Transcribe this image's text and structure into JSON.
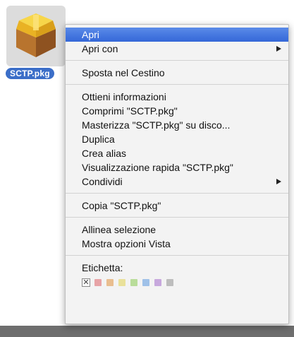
{
  "file": {
    "name": "SCTP.pkg",
    "icon": "package-icon"
  },
  "menu": {
    "items": [
      {
        "label": "Apri",
        "submenu": false,
        "highlighted": true
      },
      {
        "label": "Apri con",
        "submenu": true
      },
      {
        "label": "Sposta nel Cestino",
        "submenu": false
      },
      {
        "label": "Ottieni informazioni",
        "submenu": false
      },
      {
        "label": "Comprimi \"SCTP.pkg\"",
        "submenu": false
      },
      {
        "label": "Masterizza \"SCTP.pkg\" su disco...",
        "submenu": false
      },
      {
        "label": "Duplica",
        "submenu": false
      },
      {
        "label": "Crea alias",
        "submenu": false
      },
      {
        "label": "Visualizzazione rapida \"SCTP.pkg\"",
        "submenu": false
      },
      {
        "label": "Condividi",
        "submenu": true
      },
      {
        "label": "Copia \"SCTP.pkg\"",
        "submenu": false
      },
      {
        "label": "Allinea selezione",
        "submenu": false
      },
      {
        "label": "Mostra opzioni Vista",
        "submenu": false
      }
    ],
    "label_section": {
      "title": "Etichetta:",
      "none_symbol": "✕",
      "colors": [
        "#e7a3a6",
        "#e9be8f",
        "#e9e19a",
        "#b9dd9a",
        "#9fc1e8",
        "#c7a8dd",
        "#bdbdbd"
      ]
    }
  },
  "colors": {
    "highlight": "#3467d8",
    "file_label_bg": "#3b6ec8"
  }
}
